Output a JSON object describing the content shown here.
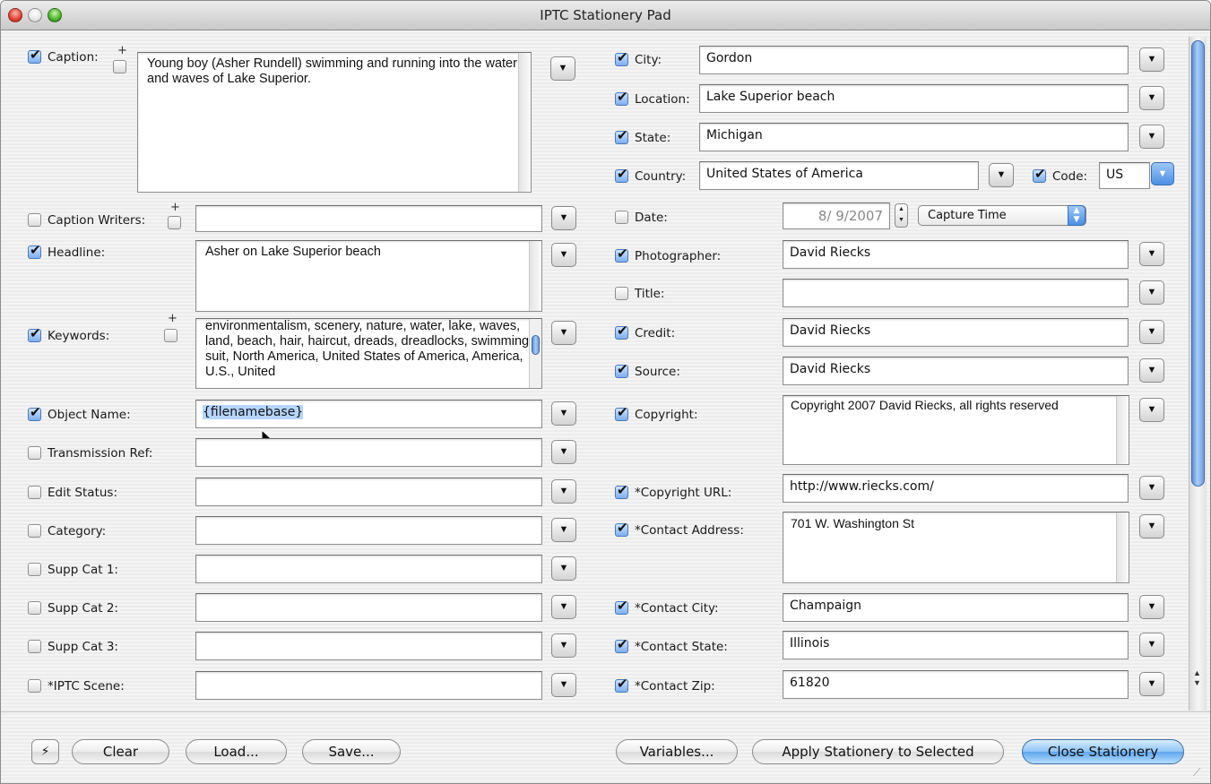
{
  "window": {
    "title": "IPTC Stationery Pad"
  },
  "left": {
    "caption": {
      "label": "Caption:",
      "checked": true,
      "text": "Young boy (Asher Rundell) swimming and running into the water and waves of Lake Superior."
    },
    "caption_writers": {
      "label": "Caption Writers:",
      "checked": false,
      "value": ""
    },
    "headline": {
      "label": "Headline:",
      "checked": true,
      "text": "Asher on Lake Superior beach"
    },
    "keywords": {
      "label": "Keywords:",
      "checked": true,
      "text": "environmentalism, scenery, nature, water, lake, waves, land, beach, hair, haircut, dreads, dreadlocks, swimming suit, North America, United States of America, America, U.S., United"
    },
    "object_name": {
      "label": "Object Name:",
      "checked": true,
      "value": "{filenamebase}"
    },
    "transmission_ref": {
      "label": "Transmission Ref:",
      "checked": false,
      "value": ""
    },
    "edit_status": {
      "label": "Edit Status:",
      "checked": false,
      "value": ""
    },
    "category": {
      "label": "Category:",
      "checked": false,
      "value": ""
    },
    "supp_cat_1": {
      "label": "Supp Cat 1:",
      "checked": false,
      "value": ""
    },
    "supp_cat_2": {
      "label": "Supp Cat 2:",
      "checked": false,
      "value": ""
    },
    "supp_cat_3": {
      "label": "Supp Cat 3:",
      "checked": false,
      "value": ""
    },
    "iptc_scene": {
      "label": "*IPTC Scene:",
      "checked": false,
      "value": ""
    }
  },
  "right": {
    "city": {
      "label": "City:",
      "checked": true,
      "value": "Gordon"
    },
    "location": {
      "label": "Location:",
      "checked": true,
      "value": "Lake Superior beach"
    },
    "state": {
      "label": "State:",
      "checked": true,
      "value": "Michigan"
    },
    "country": {
      "label": "Country:",
      "checked": true,
      "value": "United States of America"
    },
    "code": {
      "label": "Code:",
      "checked": true,
      "value": "US"
    },
    "date": {
      "label": "Date:",
      "checked": false,
      "value": "8/ 9/2007",
      "source": "Capture Time"
    },
    "photographer": {
      "label": "Photographer:",
      "checked": true,
      "value": "David Riecks"
    },
    "title": {
      "label": "Title:",
      "checked": false,
      "value": ""
    },
    "credit": {
      "label": "Credit:",
      "checked": true,
      "value": "David Riecks"
    },
    "source": {
      "label": "Source:",
      "checked": true,
      "value": "David Riecks"
    },
    "copyright": {
      "label": "Copyright:",
      "checked": true,
      "text": "Copyright 2007 David Riecks, all rights reserved"
    },
    "copyright_url": {
      "label": "*Copyright URL:",
      "checked": true,
      "value": "http://www.riecks.com/"
    },
    "contact_address": {
      "label": "*Contact Address:",
      "checked": true,
      "text": "701 W. Washington St"
    },
    "contact_city": {
      "label": "*Contact City:",
      "checked": true,
      "value": "Champaign"
    },
    "contact_state": {
      "label": "*Contact State:",
      "checked": true,
      "value": "Illinois"
    },
    "contact_zip": {
      "label": "*Contact Zip:",
      "checked": true,
      "value": "61820"
    }
  },
  "buttons": {
    "clear": "Clear",
    "load": "Load...",
    "save": "Save...",
    "variables": "Variables...",
    "apply": "Apply Stationery to Selected",
    "close": "Close Stationery"
  },
  "icons": {
    "lightning": "⚡",
    "popup_arrow": "▼",
    "plus": "+"
  },
  "colors": {
    "accent": "#5ea6ee",
    "checkbox_on": "#7eaef0",
    "close_light": "#e2402f",
    "zoom_light": "#4ab12a"
  }
}
